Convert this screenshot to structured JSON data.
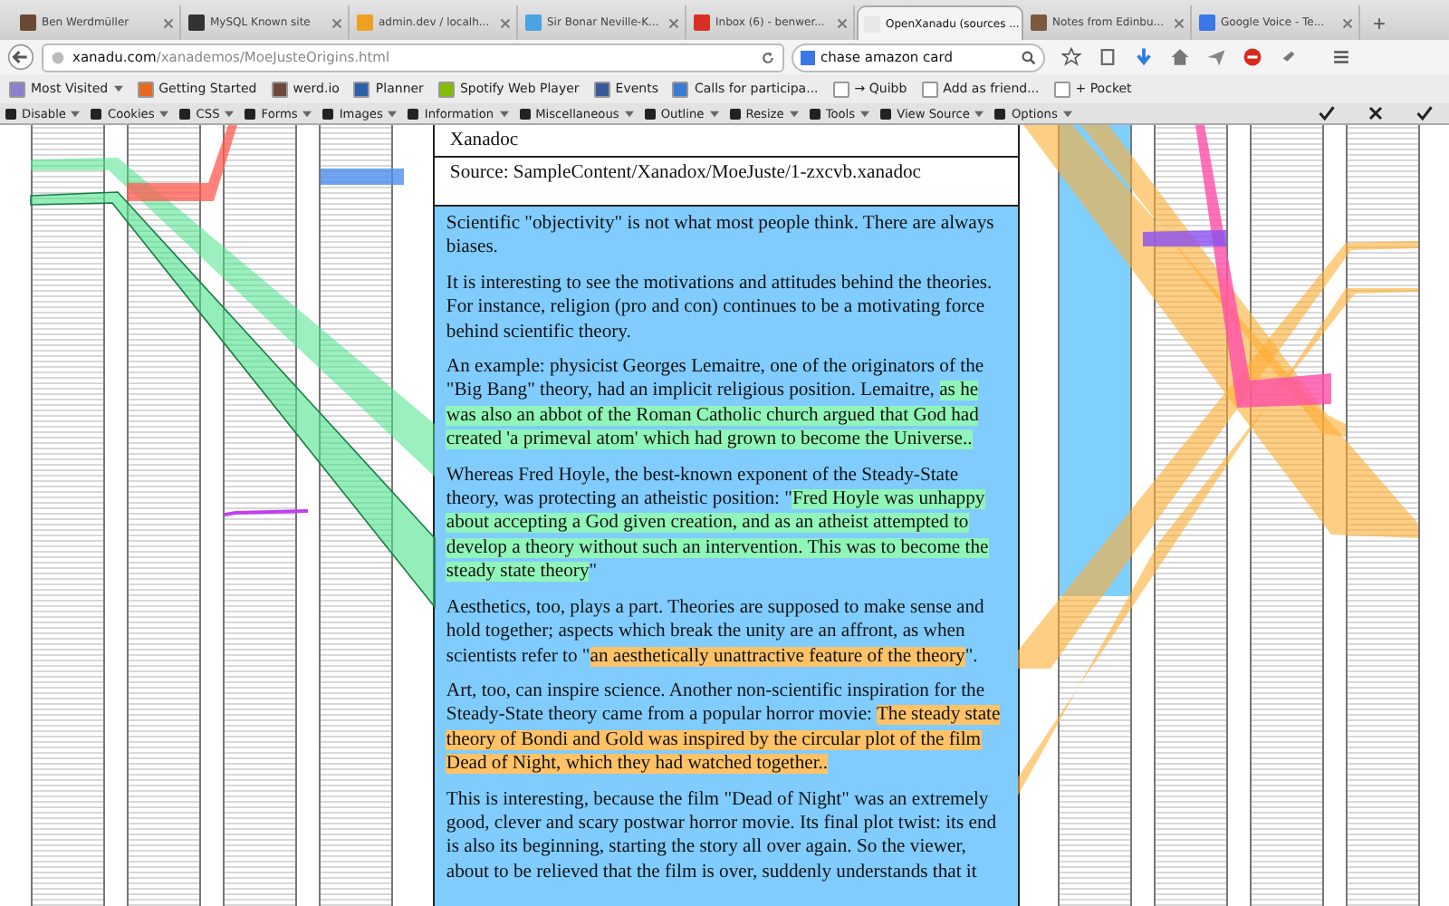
{
  "tabs": [
    {
      "title": "Ben Werdmüller",
      "selected": false,
      "color": "#6b4a35"
    },
    {
      "title": "MySQL Known site",
      "selected": false,
      "color": "#333333"
    },
    {
      "title": "admin.dev / localh...",
      "selected": false,
      "color": "#f0a020"
    },
    {
      "title": "Sir Bonar Neville-K...",
      "selected": false,
      "color": "#4aa3e0"
    },
    {
      "title": "Inbox (6) - benwer...",
      "selected": false,
      "color": "#d93025"
    },
    {
      "title": "OpenXanadu (sources ...",
      "selected": true,
      "color": "#e8e8e8"
    },
    {
      "title": "Notes from Edinbu...",
      "selected": false,
      "color": "#7a5a40"
    },
    {
      "title": "Google Voice - Te...",
      "selected": false,
      "color": "#3b78e7"
    }
  ],
  "new_tab": "+",
  "address_bar": {
    "host": "xanadu.com",
    "path": "/xanademos/MoeJusteOrigins.html"
  },
  "search": {
    "value": "chase amazon card"
  },
  "bookmarks": [
    {
      "label": "Most Visited",
      "color": "#8a7fd0",
      "dropdown": true
    },
    {
      "label": "Getting Started",
      "color": "#e66a1f",
      "dropdown": false
    },
    {
      "label": "werd.io",
      "color": "#6b4a35",
      "dropdown": false
    },
    {
      "label": "Planner",
      "color": "#2d5fa8",
      "dropdown": false
    },
    {
      "label": "Spotify Web Player",
      "color": "#84bd00",
      "dropdown": false
    },
    {
      "label": "Events",
      "color": "#3b5998",
      "dropdown": false
    },
    {
      "label": "Calls for participa...",
      "color": "#3a7bd5",
      "dropdown": false
    },
    {
      "label": "→ Quibb",
      "color": "#ffffff",
      "dropdown": false
    },
    {
      "label": "Add as friend...",
      "color": "#ffffff",
      "dropdown": false
    },
    {
      "label": "+ Pocket",
      "color": "#ffffff",
      "dropdown": false
    }
  ],
  "dev_toolbar": [
    "Disable",
    "Cookies",
    "CSS",
    "Forms",
    "Images",
    "Information",
    "Miscellaneous",
    "Outline",
    "Resize",
    "Tools",
    "View Source",
    "Options"
  ],
  "document": {
    "title": "Xanadoc",
    "source": "Source: SampleContent/Xanadox/MoeJuste/1-zxcvb.xanadoc",
    "paragraphs": [
      {
        "segments": [
          {
            "text": "Scientific \"objectivity\" is not what most people think. There are always biases.",
            "kind": "plain"
          }
        ]
      },
      {
        "segments": [
          {
            "text": "It is interesting to see the motivations and attitudes behind the theories. For instance, religion (pro and con) continues to be a motivating force behind scientific theory.",
            "kind": "plain"
          }
        ]
      },
      {
        "segments": [
          {
            "text": "An example: physicist Georges Lemaitre, one of the originators of the \"Big Bang\" theory, had an implicit religious position. Lemaitre, ",
            "kind": "plain"
          },
          {
            "text": "as he was also an abbot of the Roman Catholic church argued that God had created 'a primeval atom' which had grown to become the Universe..",
            "kind": "highlight",
            "color": "#8ff5b8"
          }
        ]
      },
      {
        "segments": [
          {
            "text": "Whereas Fred Hoyle, the best-known exponent of the Steady-State theory, was protecting an atheistic position: \"",
            "kind": "plain"
          },
          {
            "text": "Fred Hoyle was unhappy about accepting a God given creation, and as an atheist attempted to develop a theory without such an intervention. This was to become the steady state theory",
            "kind": "highlight",
            "color": "#8ff5b8"
          },
          {
            "text": "\"",
            "kind": "plain"
          }
        ]
      },
      {
        "segments": [
          {
            "text": "Aesthetics, too, plays a part. Theories are supposed to make sense and hold together; aspects which break the unity are an affront, as when scientists refer to \"",
            "kind": "plain"
          },
          {
            "text": "an aesthetically unattractive feature of the theory",
            "kind": "highlight",
            "color": "#ffc266"
          },
          {
            "text": "\".",
            "kind": "plain"
          }
        ]
      },
      {
        "segments": [
          {
            "text": "Art, too, can inspire science. Another non-scientific inspiration for the Steady-State theory came from a popular horror movie: ",
            "kind": "plain"
          },
          {
            "text": "The steady state theory of Bondi and Gold was inspired by the circular plot of the film Dead of Night, which they had watched together..",
            "kind": "highlight",
            "color": "#ffc266"
          }
        ]
      },
      {
        "segments": [
          {
            "text": "This is interesting, because the film \"Dead of Night\" was an extremely good, clever and scary postwar horror movie. Its final plot twist: its end is also its beginning, starting the story all over again. So the viewer, about to be relieved that the film is over, suddenly understands that it",
            "kind": "plain"
          }
        ]
      }
    ]
  },
  "left_documents": [
    {
      "highlighted": false
    },
    {
      "highlighted": false
    },
    {
      "highlighted": false
    },
    {
      "highlighted": false
    }
  ],
  "right_documents": [
    {
      "highlighted": true
    },
    {
      "highlighted": false
    },
    {
      "highlighted": false
    },
    {
      "highlighted": false
    }
  ]
}
